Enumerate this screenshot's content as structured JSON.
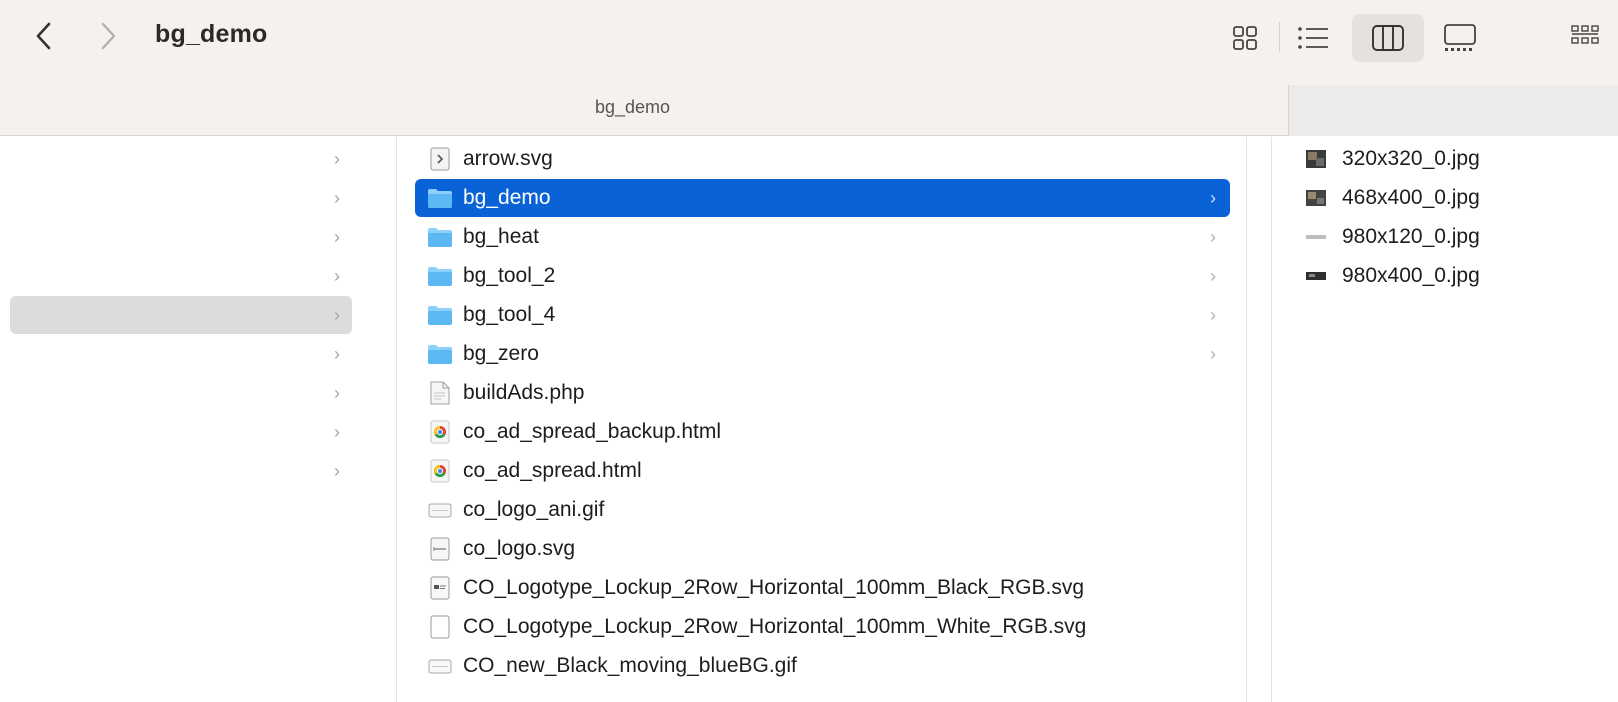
{
  "window": {
    "title": "bg_demo"
  },
  "toolbar": {
    "back_icon": "chevron-left-icon",
    "forward_icon": "chevron-right-icon",
    "views": [
      {
        "name": "icon-view",
        "active": false
      },
      {
        "name": "list-view",
        "active": false
      },
      {
        "name": "column-view",
        "active": true
      },
      {
        "name": "gallery-view",
        "active": false
      },
      {
        "name": "group-view",
        "active": false
      }
    ]
  },
  "pathbar": {
    "label": "bg_demo"
  },
  "column1": {
    "rows": 9,
    "selected_index": 4,
    "chevron": "›"
  },
  "column2": {
    "items": [
      {
        "name": "arrow.svg",
        "type": "svg-file",
        "folder": false
      },
      {
        "name": "bg_demo",
        "type": "folder",
        "folder": true,
        "selected": true
      },
      {
        "name": "bg_heat",
        "type": "folder",
        "folder": true
      },
      {
        "name": "bg_tool_2",
        "type": "folder",
        "folder": true
      },
      {
        "name": "bg_tool_4",
        "type": "folder",
        "folder": true
      },
      {
        "name": "bg_zero",
        "type": "folder",
        "folder": true
      },
      {
        "name": "buildAds.php",
        "type": "php-file",
        "folder": false
      },
      {
        "name": "co_ad_spread_backup.html",
        "type": "chrome-html",
        "folder": false
      },
      {
        "name": "co_ad_spread.html",
        "type": "chrome-html",
        "folder": false
      },
      {
        "name": "co_logo_ani.gif",
        "type": "gif-file",
        "folder": false
      },
      {
        "name": "co_logo.svg",
        "type": "svg-doc",
        "folder": false
      },
      {
        "name": "CO_Logotype_Lockup_2Row_Horizontal_100mm_Black_RGB.svg",
        "type": "svg-thumb",
        "folder": false
      },
      {
        "name": "CO_Logotype_Lockup_2Row_Horizontal_100mm_White_RGB.svg",
        "type": "blank-doc",
        "folder": false
      },
      {
        "name": "CO_new_Black_moving_blueBG.gif",
        "type": "gif-file",
        "folder": false
      }
    ]
  },
  "column3": {
    "items": [
      {
        "name": "320x320_0.jpg",
        "type": "jpg-thumb"
      },
      {
        "name": "468x400_0.jpg",
        "type": "jpg-thumb"
      },
      {
        "name": "980x120_0.jpg",
        "type": "jpg-wide"
      },
      {
        "name": "980x400_0.jpg",
        "type": "jpg-dark"
      }
    ]
  },
  "colors": {
    "selection": "#0a63d6",
    "folder": "#5bb6f0",
    "toolbar_bg": "#f7f1ed"
  }
}
